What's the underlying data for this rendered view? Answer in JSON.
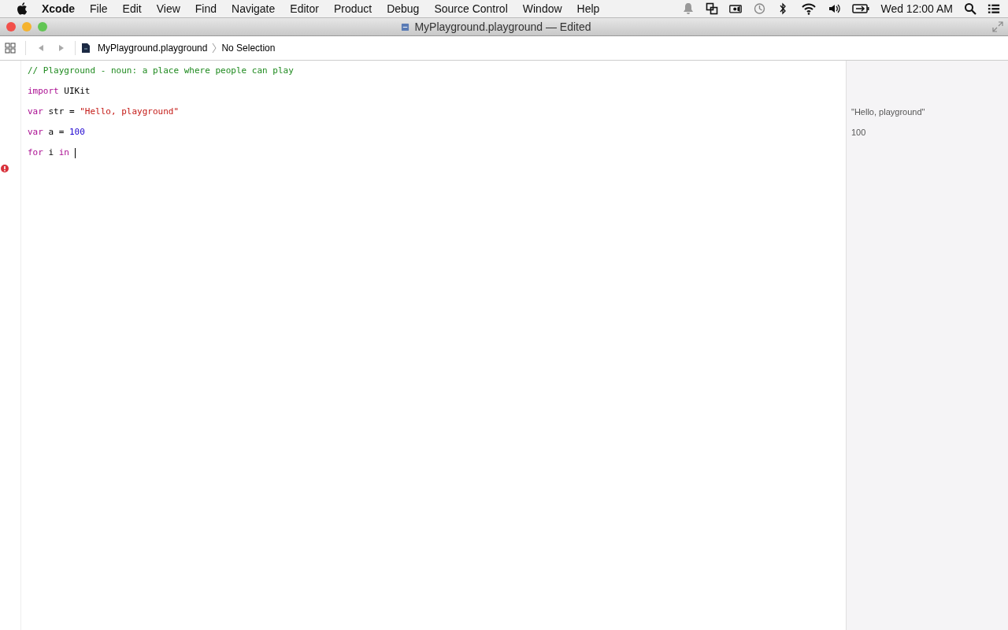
{
  "menu_bar": {
    "app_name": "Xcode",
    "menus": [
      "File",
      "Edit",
      "View",
      "Find",
      "Navigate",
      "Editor",
      "Product",
      "Debug",
      "Source Control",
      "Window",
      "Help"
    ],
    "clock": "Wed 12:00 AM"
  },
  "window": {
    "title": "MyPlayground.playground — Edited"
  },
  "toolbar": {
    "breadcrumb": [
      "MyPlayground.playground",
      "No Selection"
    ]
  },
  "editor": {
    "lines": [
      {
        "tokens": [
          {
            "kind": "comment",
            "text": "// Playground - noun: a place where people can play"
          }
        ]
      },
      {
        "tokens": [
          {
            "kind": "keyword",
            "text": "import"
          },
          {
            "kind": "plain",
            "text": " UIKit"
          }
        ]
      },
      {
        "tokens": [
          {
            "kind": "keyword",
            "text": "var"
          },
          {
            "kind": "plain",
            "text": " str = "
          },
          {
            "kind": "string",
            "text": "\"Hello, playground\""
          }
        ],
        "result": "\"Hello, playground\""
      },
      {
        "tokens": [
          {
            "kind": "keyword",
            "text": "var"
          },
          {
            "kind": "plain",
            "text": " a = "
          },
          {
            "kind": "number",
            "text": "100"
          }
        ],
        "result": "100"
      },
      {
        "tokens": [
          {
            "kind": "keyword",
            "text": "for"
          },
          {
            "kind": "plain",
            "text": " i "
          },
          {
            "kind": "keyword",
            "text": "in"
          }
        ],
        "cursor": true,
        "error": true
      }
    ]
  }
}
